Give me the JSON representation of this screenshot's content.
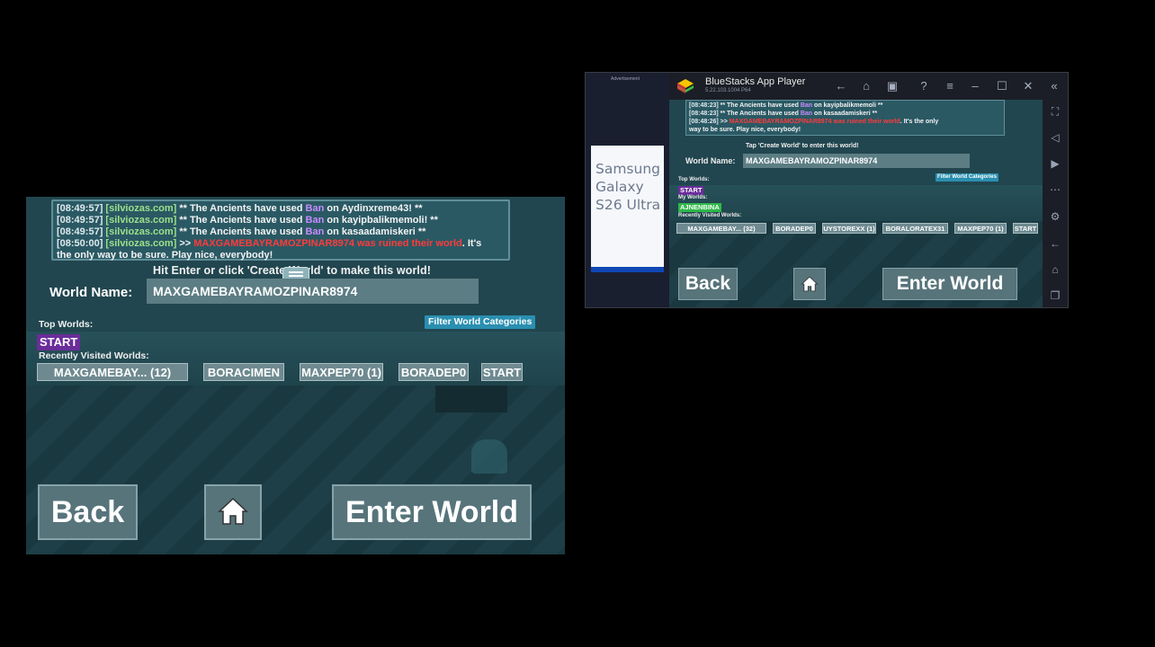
{
  "left_game": {
    "chat": [
      {
        "ts": "[08:49:57]",
        "src": "[silviozas.com]",
        "pre": " ** The Ancients have used ",
        "ban": "Ban",
        "post": " on Aydinxreme43! **"
      },
      {
        "ts": "[08:49:57]",
        "src": "[silviozas.com]",
        "pre": " ** The Ancients have used ",
        "ban": "Ban",
        "post": " on kayipbalikmemoli! **"
      },
      {
        "ts": "[08:49:57]",
        "src": "[silviozas.com]",
        "pre": " ** The Ancients have used ",
        "ban": "Ban",
        "post": " on kasaadamiskeri **"
      },
      {
        "ts": "[08:50:00]",
        "src": "[silviozas.com]",
        "pre": " >> ",
        "red": "MAXGAMEBAYRAMOZPINAR8974 was ruined their world",
        "post": ". It's"
      }
    ],
    "chat_wrap": "the only way to be sure. Play nice, everybody!",
    "hint": "Hit Enter or click 'Create World' to make this world!",
    "world_name_label": "World Name:",
    "world_name_value": "MAXGAMEBAYRAMOZPINAR8974",
    "top_worlds_label": "Top Worlds:",
    "filter_label": "Filter World Categories",
    "top_world": "START",
    "recent_label": "Recently Visited Worlds:",
    "recent_worlds": [
      "MAXGAMEBAY... (12)",
      "BORACIMEN",
      "MAXPEP70 (1)",
      "BORADEP0",
      "START"
    ],
    "back_label": "Back",
    "enter_label": "Enter World"
  },
  "bluestacks": {
    "title": "BlueStacks App Player",
    "version": "5.22.103.1004  P64",
    "ad_label": "Advertisement",
    "ad_text_1": "Samsung",
    "ad_text_2": "Galaxy",
    "ad_text_3": "S26 Ultra",
    "chat": [
      {
        "ts": "[08:48:23]",
        "src": "",
        "pre": " ** The Ancients have used ",
        "ban": "Ban",
        "post": " on kayipbalikmemoli **"
      },
      {
        "ts": "[08:48:23]",
        "src": "",
        "pre": " ** The Ancients have used ",
        "ban": "Ban",
        "post": " on kasaadamiskeri **"
      },
      {
        "ts": "[08:48:26]",
        "src": "",
        "pre": " >> ",
        "red": "MAXGAMEBAYRAMOZPINAR8974 was ruined their world",
        "post": ". It's the only"
      }
    ],
    "chat_wrap": "way to be sure. Play nice, everybody!",
    "hint": "Tap 'Create World' to enter this world!",
    "world_name_label": "World Name:",
    "world_name_value": "MAXGAMEBAYRAMOZPINAR8974",
    "top_worlds_label": "Top Worlds:",
    "filter_label": "Filter World Categories",
    "top_world": "START",
    "my_worlds_label": "My Worlds:",
    "my_world": "AJNENBINA",
    "recent_label": "Recently Visited Worlds:",
    "recent_worlds": [
      "MAXGAMEBAY... (32)",
      "BORADEP0",
      "UYSTOREXX (1)",
      "BORALORATEX31",
      "MAXPEP70 (1)",
      "START"
    ],
    "back_label": "Back",
    "enter_label": "Enter World"
  },
  "colors": {
    "accent_purple": "#6a2d9a",
    "filter_blue": "#2a8fb0",
    "ban_purple": "#c78cff",
    "chat_green": "#9de08a",
    "alert_red": "#ff3b3b",
    "my_world_green": "#2fb84a"
  }
}
